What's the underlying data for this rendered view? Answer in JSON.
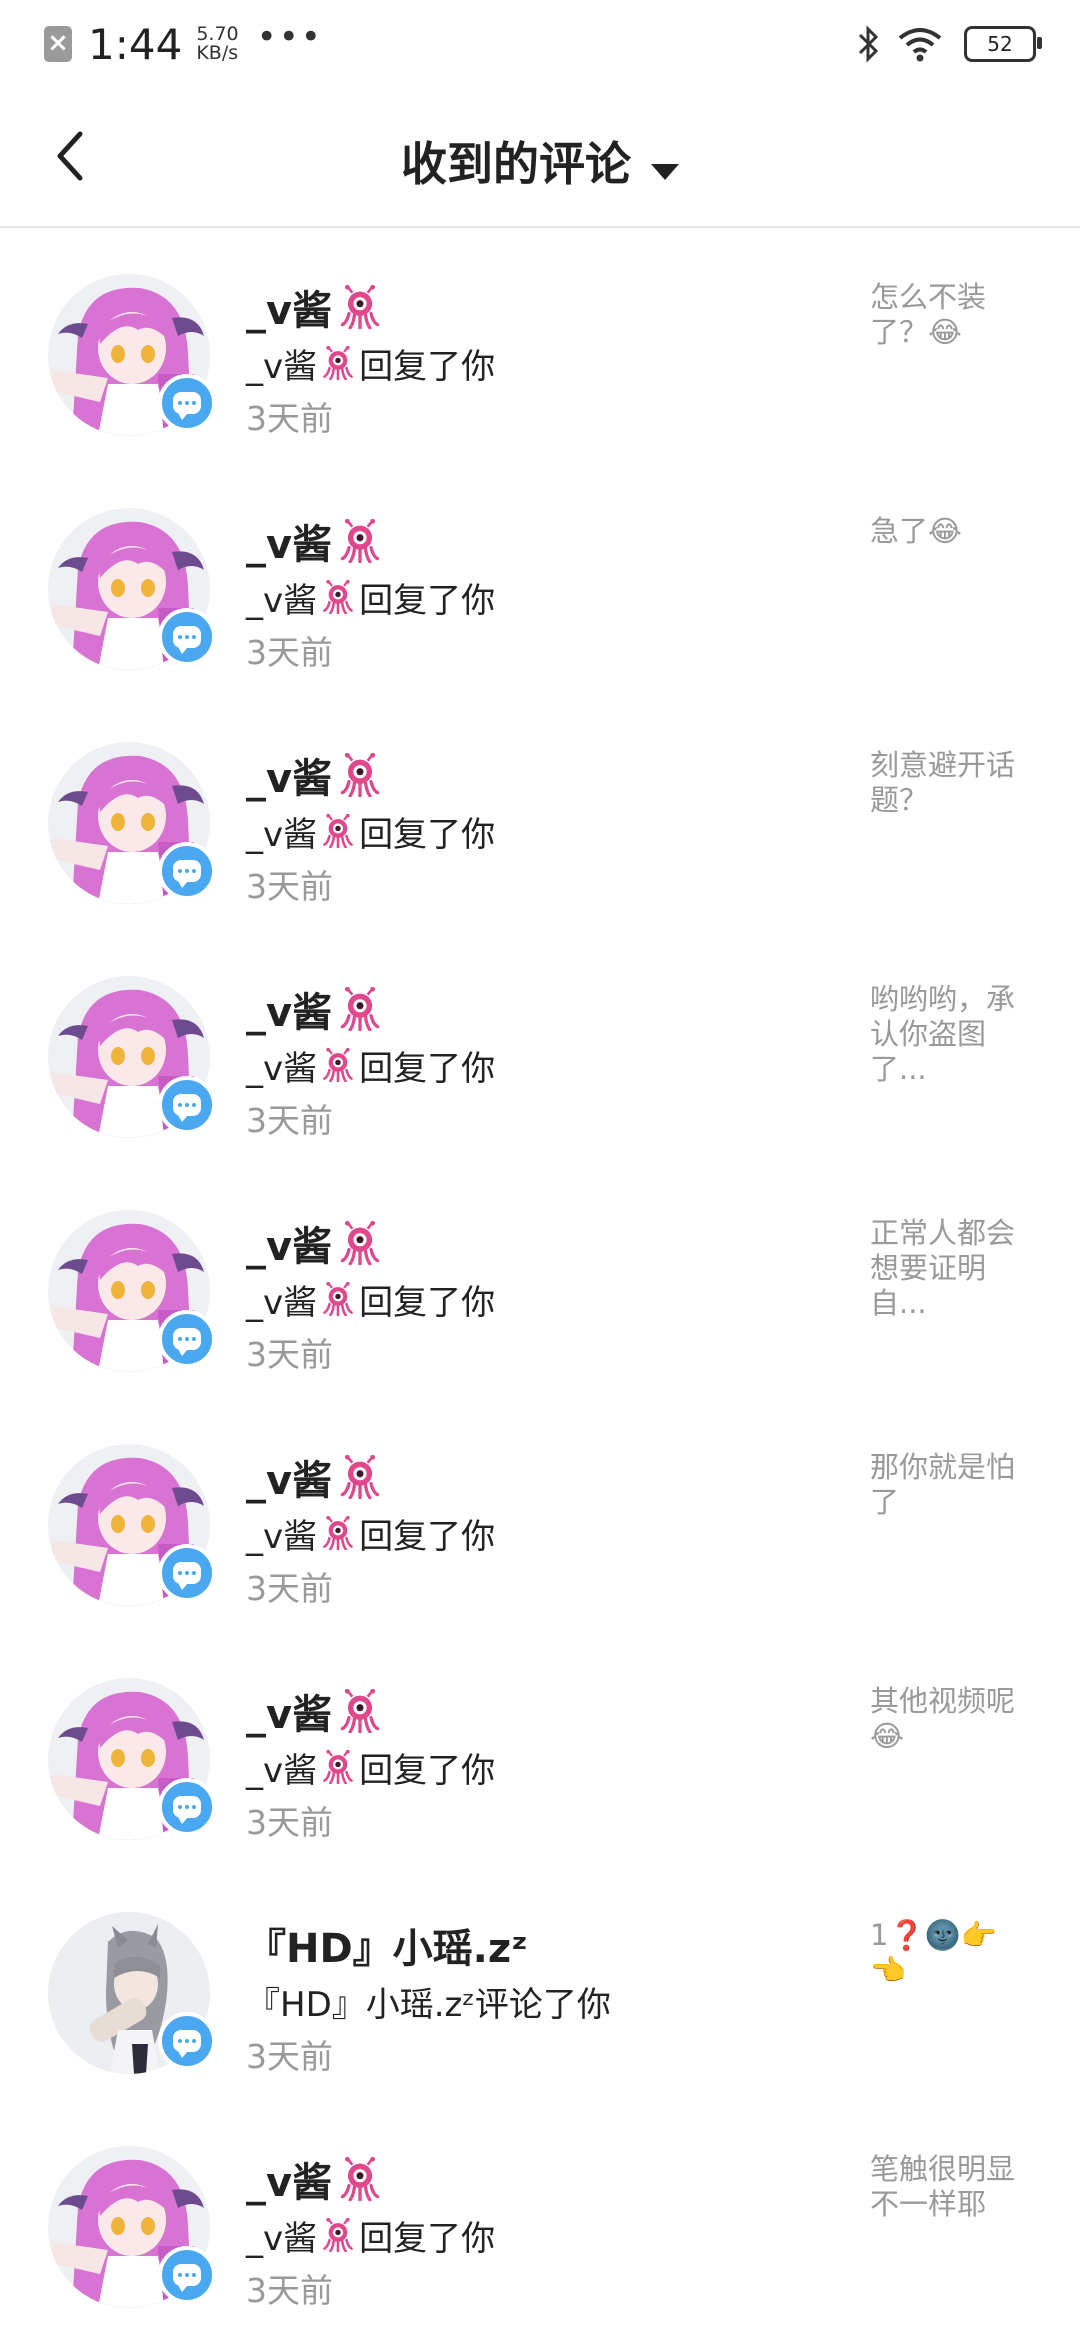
{
  "status": {
    "time": "1:44",
    "net_speed_value": "5.70",
    "net_speed_unit": "KB/s",
    "more": "•••",
    "battery": "52"
  },
  "header": {
    "title": "收到的评论"
  },
  "rows": [
    {
      "name": "_v酱",
      "desc": "_v酱",
      "action": "回复了你",
      "time": "3天前",
      "comment": "怎么不装了？😂",
      "avatar": "pink"
    },
    {
      "name": "_v酱",
      "desc": "_v酱",
      "action": "回复了你",
      "time": "3天前",
      "comment": "急了😂",
      "avatar": "pink"
    },
    {
      "name": "_v酱",
      "desc": "_v酱",
      "action": "回复了你",
      "time": "3天前",
      "comment": "刻意避开话题？",
      "avatar": "pink"
    },
    {
      "name": "_v酱",
      "desc": "_v酱",
      "action": "回复了你",
      "time": "3天前",
      "comment": "哟哟哟，承认你盗图了...",
      "avatar": "pink"
    },
    {
      "name": "_v酱",
      "desc": "_v酱",
      "action": "回复了你",
      "time": "3天前",
      "comment": "正常人都会想要证明自...",
      "avatar": "pink"
    },
    {
      "name": "_v酱",
      "desc": "_v酱",
      "action": "回复了你",
      "time": "3天前",
      "comment": "那你就是怕了",
      "avatar": "pink"
    },
    {
      "name": "_v酱",
      "desc": "_v酱",
      "action": "回复了你",
      "time": "3天前",
      "comment": "其他视频呢😂",
      "avatar": "pink"
    },
    {
      "name": "『HD』小瑶.zᶻ",
      "desc": "『HD』小瑶.zᶻ",
      "action": "评论了你",
      "time": "3天前",
      "comment": "1❓🌚👉👈",
      "avatar": "grey"
    },
    {
      "name": "_v酱",
      "desc": "_v酱",
      "action": "回复了你",
      "time": "3天前",
      "comment": "笔触很明显不一样耶",
      "avatar": "pink"
    }
  ]
}
